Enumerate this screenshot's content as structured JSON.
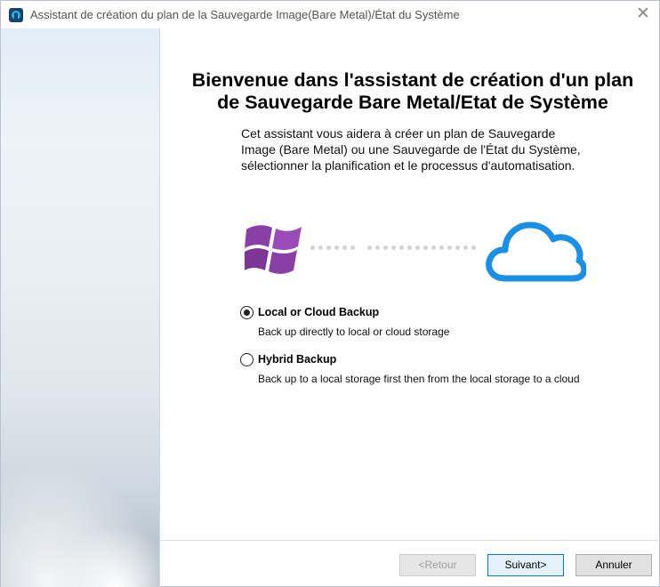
{
  "window": {
    "title": "Assistant de création du plan de la Sauvegarde Image(Bare Metal)/État du Système",
    "close_glyph": "✕"
  },
  "main": {
    "heading_line1": "Bienvenue dans l'assistant de création d'un plan",
    "heading_line2": "de Sauvegarde Bare Metal/Etat de Système",
    "intro": "Cet assistant vous aidera à créer un plan de Sauvegarde Image (Bare Metal) ou une Sauvegarde de l'État du Système, sélectionner la planification et le processus d'automatisation.",
    "illustration": {
      "left_icon": "windows-logo-icon",
      "right_icon": "cloud-icon",
      "windows_color": "#8b3fa6",
      "cloud_color": "#1a8fe3",
      "dot_color": "#d0d4d9"
    },
    "options": [
      {
        "title": "Local or Cloud Backup",
        "description": "Back up directly to local or cloud storage",
        "selected": true
      },
      {
        "title": "Hybrid Backup",
        "description": "Back up to a local storage first then from the local storage to a cloud",
        "selected": false
      }
    ]
  },
  "footer": {
    "back_label": "<Retour",
    "next_label": "Suivant>",
    "cancel_label": "Annuler"
  },
  "colors": {
    "accent": "#0078d7",
    "disabled_text": "#a0a0a0"
  }
}
